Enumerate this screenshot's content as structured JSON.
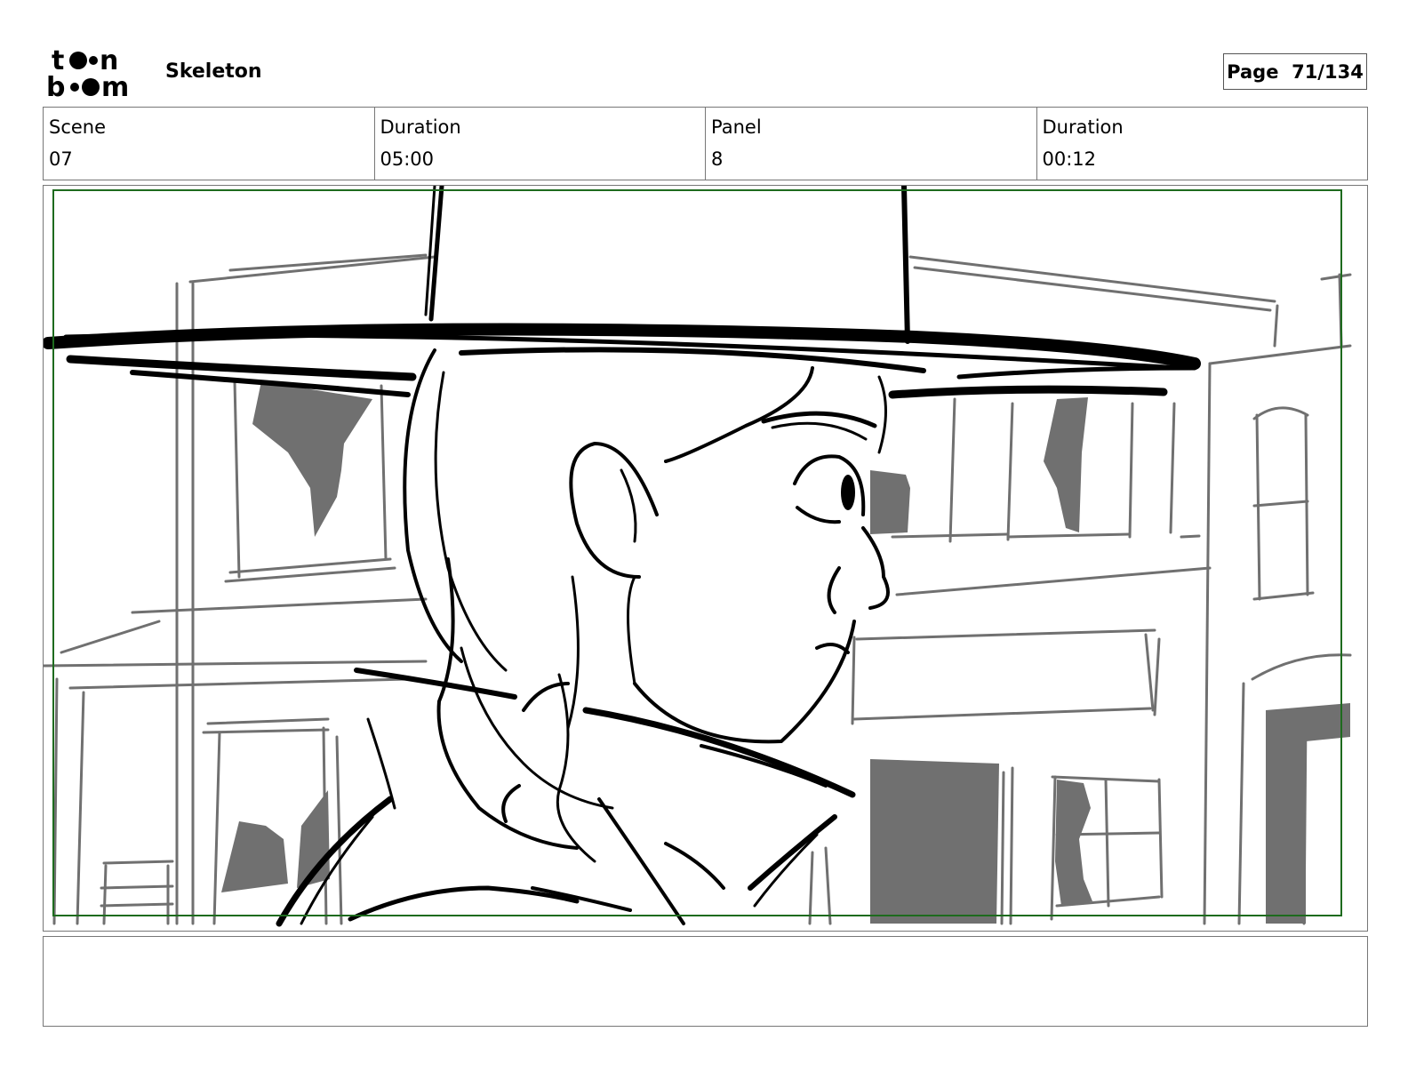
{
  "header": {
    "logo_text": [
      "t",
      "n",
      "b",
      "m"
    ],
    "project_title": "Skeleton",
    "page_label": "Page",
    "page_value": "71/134"
  },
  "info": {
    "scene_label": "Scene",
    "scene_value": "07",
    "scene_duration_label": "Duration",
    "scene_duration_value": "05:00",
    "panel_label": "Panel",
    "panel_value": "8",
    "panel_duration_label": "Duration",
    "panel_duration_value": "00:12"
  },
  "colors": {
    "safe_area_border": "#1e6b1e",
    "background_sketch": "#707070",
    "foreground_sketch": "#000000"
  },
  "notes": {
    "text": ""
  }
}
